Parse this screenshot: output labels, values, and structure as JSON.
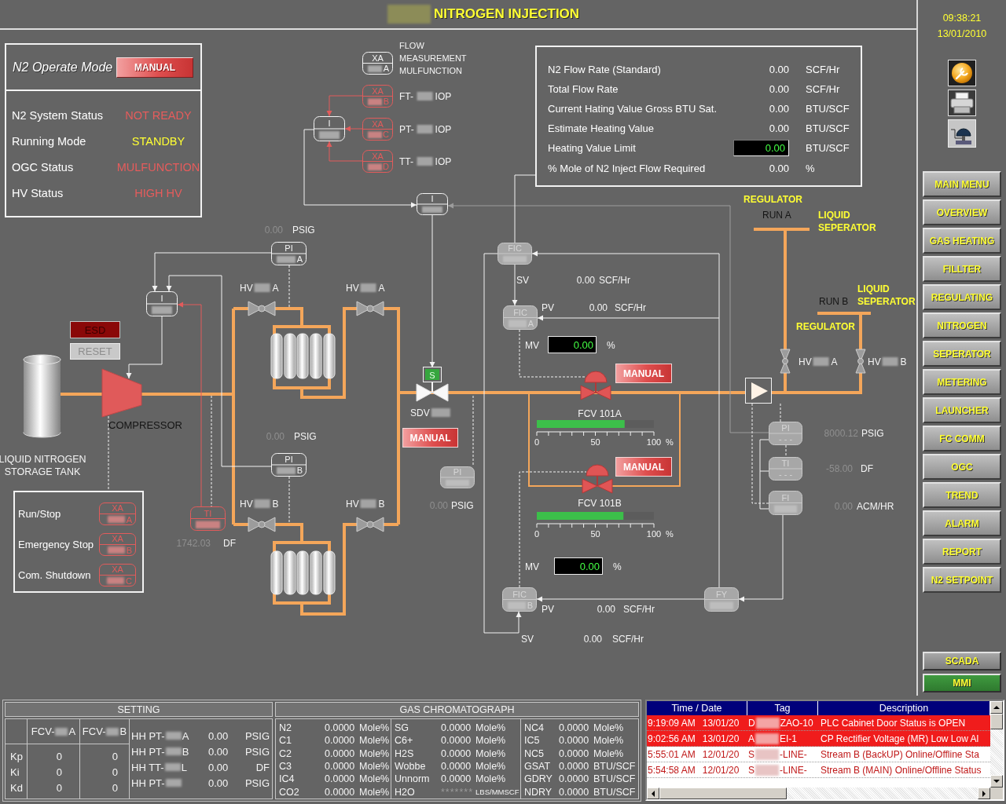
{
  "header": {
    "title": "NITROGEN INJECTION"
  },
  "clock": {
    "time": "09:38:21",
    "date": "13/01/2010"
  },
  "nav": [
    {
      "label": "MAIN MENU",
      "selected": false
    },
    {
      "label": "OVERVIEW",
      "selected": false
    },
    {
      "label": "GAS HEATING",
      "selected": false
    },
    {
      "label": "FILLTER",
      "selected": false
    },
    {
      "label": "REGULATING",
      "selected": false
    },
    {
      "label": "NITROGEN",
      "selected": false
    },
    {
      "label": "SEPERATOR",
      "selected": false
    },
    {
      "label": "METERING",
      "selected": false
    },
    {
      "label": "LAUNCHER",
      "selected": false
    },
    {
      "label": "FC COMM",
      "selected": false
    },
    {
      "label": "OGC",
      "selected": false
    },
    {
      "label": "TREND",
      "selected": false
    },
    {
      "label": "ALARM",
      "selected": false
    },
    {
      "label": "REPORT",
      "selected": false
    },
    {
      "label": "N2 SETPOINT",
      "selected": false
    }
  ],
  "system_switch": [
    {
      "label": "SCADA",
      "selected": false
    },
    {
      "label": "MMI",
      "selected": true
    }
  ],
  "operate_mode": {
    "label": "N2 Operate Mode",
    "button": "MANUAL"
  },
  "status": [
    {
      "label": "N2 System Status",
      "value": "NOT READY",
      "color": "#e65c5c"
    },
    {
      "label": "Running Mode",
      "value": "STANDBY",
      "color": "#ffff33"
    },
    {
      "label": "OGC Status",
      "value": "MULFUNCTION",
      "color": "#e65c5c"
    },
    {
      "label": "HV Status",
      "value": "HIGH HV",
      "color": "#e65c5c"
    }
  ],
  "flow_panel": [
    {
      "label": "N2 Flow Rate (Standard)",
      "value": "0.00",
      "unit": "SCF/Hr",
      "kind": "reading"
    },
    {
      "label": "Total Flow Rate",
      "value": "0.00",
      "unit": "SCF/Hr",
      "kind": "reading"
    },
    {
      "label": "Current Hating Value Gross BTU Sat.",
      "value": "0.00",
      "unit": "BTU/SCF",
      "kind": "reading"
    },
    {
      "label": "Estimate Heating Value",
      "value": "0.00",
      "unit": "BTU/SCF",
      "kind": "reading"
    },
    {
      "label": "Heating Value Limit",
      "value": "0.00",
      "unit": "BTU/SCF",
      "kind": "input"
    },
    {
      "label": "% Mole of N2 Inject Flow Required",
      "value": "0.00",
      "unit": "%",
      "kind": "reading"
    }
  ],
  "diagram": {
    "legend": {
      "tag": "XA",
      "suffix": "A",
      "blurred": true,
      "kind": "normal",
      "lines": [
        "FLOW",
        "MEASUREMENT",
        "MULFUNCTION"
      ]
    },
    "iop_alarms": [
      {
        "tag": "XA",
        "suffix": "B",
        "blurred": true,
        "kind": "alarm",
        "name": "FT-",
        "note": "IOP"
      },
      {
        "tag": "XA",
        "suffix": "C",
        "blurred": true,
        "kind": "alarm",
        "name": "PT-",
        "note": "IOP"
      },
      {
        "tag": "XA",
        "suffix": "D",
        "blurred": true,
        "kind": "alarm",
        "name": "TT-",
        "note": "IOP"
      }
    ],
    "instruments": [
      {
        "tag": "I",
        "blurred": true,
        "kind": "normal"
      },
      {
        "tag": "I",
        "blurred": true,
        "kind": "normal"
      },
      {
        "tag": "PI",
        "suffix": "A",
        "blurred": true,
        "kind": "normal"
      },
      {
        "tag": "I",
        "blurred": true,
        "kind": "normal"
      },
      {
        "tag": "PI",
        "suffix": "B",
        "blurred": true,
        "kind": "normal"
      },
      {
        "tag": "TI",
        "blurred": true,
        "kind": "alarm"
      },
      {
        "tag": "PI",
        "blurred": true,
        "kind": "offline"
      },
      {
        "tag": "FIC",
        "blurred": true,
        "kind": "offline"
      },
      {
        "tag": "FIC",
        "suffix": "A",
        "blurred": true,
        "kind": "offline"
      },
      {
        "tag": "FIC",
        "suffix": "B",
        "blurred": true,
        "kind": "offline"
      },
      {
        "tag": "FY",
        "blurred": true,
        "kind": "offline"
      },
      {
        "tag": "PI",
        "suffix": "- - -",
        "blurred": false,
        "kind": "offline"
      },
      {
        "tag": "TI",
        "suffix": "- - -",
        "blurred": false,
        "kind": "offline"
      },
      {
        "tag": "FI",
        "blurred": true,
        "kind": "offline"
      }
    ],
    "readings": [
      {
        "value": "0.00",
        "unit": "PSIG",
        "stale": true
      },
      {
        "value": "0.00",
        "unit": "PSIG",
        "stale": true
      },
      {
        "value": "1742.03",
        "unit": "DF",
        "stale": true
      },
      {
        "value": "0.00",
        "unit": "PSIG",
        "stale": true
      },
      {
        "label": "SV",
        "value": "0.00",
        "unit": "SCF/Hr",
        "stale": false
      },
      {
        "label": "PV",
        "value": "0.00",
        "unit": "SCF/Hr",
        "stale": false
      },
      {
        "label": "PV",
        "value": "0.00",
        "unit": "SCF/Hr",
        "stale": false
      },
      {
        "label": "SV",
        "value": "0.00",
        "unit": "SCF/Hr",
        "stale": false
      },
      {
        "value": "8000.12",
        "unit": "PSIG",
        "stale": true
      },
      {
        "value": "-58.00",
        "unit": "DF",
        "stale": true
      },
      {
        "value": "0.00",
        "unit": "ACM/HR",
        "stale": true
      }
    ],
    "hand_valves": [
      {
        "name": "HV",
        "suffix": "A",
        "open": false
      },
      {
        "name": "HV",
        "suffix": "A",
        "open": false
      },
      {
        "name": "HV",
        "suffix": "B",
        "open": false
      },
      {
        "name": "HV",
        "suffix": "B",
        "open": false
      },
      {
        "name": "HV",
        "suffix": "A",
        "open": false
      },
      {
        "name": "HV",
        "suffix": "B",
        "open": false
      }
    ],
    "shutdown_valve": {
      "name": "SDV",
      "solenoid": "S",
      "open": true,
      "button": "MANUAL"
    },
    "control_valves": [
      {
        "name": "FCV 101A",
        "button": "MANUAL",
        "open": false,
        "level": 0.75,
        "scale": [
          "0",
          "50",
          "100"
        ],
        "scale_unit": "%",
        "mv_label": "MV",
        "mv": "0.00",
        "mv_unit": "%"
      },
      {
        "name": "FCV 101B",
        "button": "MANUAL",
        "open": false,
        "level": 0.74,
        "scale": [
          "0",
          "50",
          "100"
        ],
        "scale_unit": "%",
        "mv_label": "MV",
        "mv": "0.00",
        "mv_unit": "%"
      }
    ],
    "compressor": {
      "label": "COMPRESSOR"
    },
    "tank": {
      "lines": [
        "LIQUID NITROGEN",
        "STORAGE TANK"
      ]
    },
    "trip": {
      "esd": "ESD",
      "reset": "RESET",
      "reset_disabled": true
    },
    "runs": [
      {
        "regulator": "REGULATOR",
        "run": "RUN A",
        "separator": [
          "LIQUID",
          "SEPERATOR"
        ]
      },
      {
        "regulator": "REGULATOR",
        "run": "RUN B",
        "separator": [
          "LIQUID",
          "SEPERATOR"
        ]
      }
    ]
  },
  "interlocks": [
    {
      "label": "Run/Stop",
      "tag": "XA",
      "suffix": "A",
      "kind": "alarm"
    },
    {
      "label": "Emergency Stop",
      "tag": "XA",
      "suffix": "B",
      "kind": "alarm"
    },
    {
      "label": "Com. Shutdown",
      "tag": "XA",
      "suffix": "C",
      "kind": "alarm"
    }
  ],
  "setting": {
    "title": "SETTING",
    "loops": [
      {
        "pre": "FCV-",
        "post": "A"
      },
      {
        "pre": "FCV-",
        "post": "B"
      }
    ],
    "gains": [
      {
        "name": "Kp",
        "values": [
          "0",
          "0"
        ]
      },
      {
        "name": "Ki",
        "values": [
          "0",
          "0"
        ]
      },
      {
        "name": "Kd",
        "values": [
          "0",
          "0"
        ]
      }
    ],
    "limits": [
      {
        "pre": "HH PT-",
        "post": "A",
        "value": "0.00",
        "unit": "PSIG"
      },
      {
        "pre": "HH PT-",
        "post": "B",
        "value": "0.00",
        "unit": "PSIG"
      },
      {
        "pre": "HH TT-",
        "post": "L",
        "value": "0.00",
        "unit": "DF"
      },
      {
        "pre": "HH PT-",
        "value": "0.00",
        "unit": "PSIG"
      }
    ]
  },
  "gas_chromatograph": {
    "title": "GAS CHROMATOGRAPH",
    "columns": [
      [
        {
          "name": "N2",
          "value": "0.0000",
          "unit": "Mole%",
          "stale": false
        },
        {
          "name": "C1",
          "value": "0.0000",
          "unit": "Mole%",
          "stale": false
        },
        {
          "name": "C2",
          "value": "0.0000",
          "unit": "Mole%",
          "stale": false
        },
        {
          "name": "C3",
          "value": "0.0000",
          "unit": "Mole%",
          "stale": false
        },
        {
          "name": "IC4",
          "value": "0.0000",
          "unit": "Mole%",
          "stale": false
        },
        {
          "name": "CO2",
          "value": "0.0000",
          "unit": "Mole%",
          "stale": false
        }
      ],
      [
        {
          "name": "SG",
          "value": "0.0000",
          "unit": "Mole%",
          "stale": false
        },
        {
          "name": "C6+",
          "value": "0.0000",
          "unit": "Mole%",
          "stale": false
        },
        {
          "name": "H2S",
          "value": "0.0000",
          "unit": "Mole%",
          "stale": false
        },
        {
          "name": "Wobbe",
          "value": "0.0000",
          "unit": "Mole%",
          "stale": false
        },
        {
          "name": "Unnorm",
          "value": "0.0000",
          "unit": "Mole%",
          "stale": false
        },
        {
          "name": "H2O",
          "value": "*******",
          "unit": "LBS/MMSCF",
          "stale": true
        }
      ],
      [
        {
          "name": "NC4",
          "value": "0.0000",
          "unit": "Mole%",
          "stale": false
        },
        {
          "name": "IC5",
          "value": "0.0000",
          "unit": "Mole%",
          "stale": false
        },
        {
          "name": "NC5",
          "value": "0.0000",
          "unit": "Mole%",
          "stale": false
        },
        {
          "name": "GSAT",
          "value": "0.0000",
          "unit": "BTU/SCF",
          "stale": false
        },
        {
          "name": "GDRY",
          "value": "0.0000",
          "unit": "BTU/SCF",
          "stale": false
        },
        {
          "name": "NDRY",
          "value": "0.0000",
          "unit": "BTU/SCF",
          "stale": false
        }
      ]
    ]
  },
  "alarm_log": {
    "columns": [
      "Time / Date",
      "Tag",
      "Description"
    ],
    "rows": [
      {
        "time": "9:19:09 AM",
        "date": "13/01/20",
        "tag_pre": "D",
        "tag_post": "ZAO-10",
        "description": "PLC Cabinet Door Status is OPEN",
        "active": true
      },
      {
        "time": "9:02:56 AM",
        "date": "13/01/20",
        "tag_pre": "A",
        "tag_post": "EI-1",
        "description": "CP Rectifier Voltage (MR) Low Low Al",
        "active": true
      },
      {
        "time": "5:55:01 AM",
        "date": "12/01/20",
        "tag_pre": "S",
        "tag_post": "-LINE-",
        "description": "Stream B (BackUP) Online/Offline Sta",
        "active": false
      },
      {
        "time": "5:54:58 AM",
        "date": "12/01/20",
        "tag_pre": "S",
        "tag_post": "-LINE-",
        "description": "Stream B (MAIN) Online/Offline Status",
        "active": false
      }
    ]
  }
}
